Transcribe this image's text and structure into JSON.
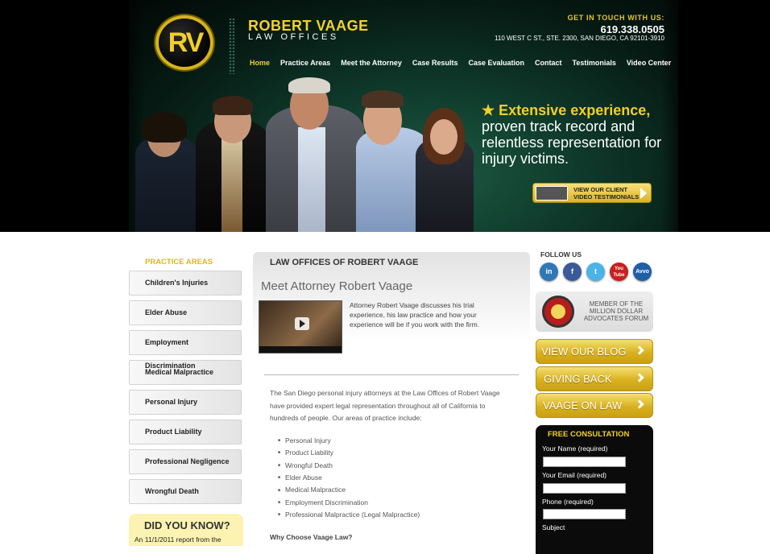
{
  "header": {
    "logo_text": "RV",
    "firm_name": "ROBERT VAAGE",
    "firm_sub": "LAW OFFICES",
    "contact_label": "GET IN TOUCH WITH US:",
    "phone": "619.338.0505",
    "address": "110 WEST C ST., STE. 2300, SAN DIEGO, CA 92101-3910"
  },
  "nav": [
    "Home",
    "Practice Areas",
    "Meet the Attorney",
    "Case Results",
    "Case Evaluation",
    "Contact",
    "Testimonials",
    "Video Center"
  ],
  "hero": {
    "star": "★",
    "tagline_highlight": "Extensive experience,",
    "tagline_rest": "proven track record and relentless representation for injury victims.",
    "video_button_line1": "VIEW OUR CLIENT",
    "video_button_line2": "VIDEO TESTIMONIALS"
  },
  "sidebar": {
    "title": "PRACTICE AREAS",
    "items": [
      "Children's Injuries",
      "Elder Abuse",
      "Employment Discrimination",
      "Medical Malpractice",
      "Personal Injury",
      "Product Liability",
      "Professional Negligence",
      "Wrongful Death"
    ],
    "dyk_title": "DID YOU KNOW?",
    "dyk_text": "An 11/1/2011 report from the"
  },
  "main": {
    "heading": "LAW OFFICES OF ROBERT VAAGE",
    "subheading": "Meet Attorney Robert Vaage",
    "video_desc": "Attorney Robert Vaage discusses his trial experience, his law practice and how your experience will be if you work with the firm.",
    "body": "The San Diego personal injury attorneys at the Law Offices of Robert Vaage have provided expert legal representation throughout all of California to hundreds of people.   Our areas of practice include:",
    "bullets": [
      "Personal Injury",
      "Product Liability",
      "Wrongful Death",
      "Elder Abuse",
      "Medical Malpractice",
      "Employment Discrimination",
      "Professional Malpractice (Legal Malpractice)"
    ],
    "why": "Why Choose Vaage Law?"
  },
  "right": {
    "follow": "FOLLOW US",
    "social": [
      {
        "label": "in",
        "icon": "linkedin-icon",
        "color": "#2f78b6"
      },
      {
        "label": "f",
        "icon": "facebook-icon",
        "color": "#3a5a99"
      },
      {
        "label": "t",
        "icon": "twitter-icon",
        "color": "#4ab3e8"
      },
      {
        "label": "You Tube",
        "icon": "youtube-icon",
        "color": "#c8201e"
      },
      {
        "label": "Avvo",
        "icon": "avvo-icon",
        "color": "#1f5fa6"
      }
    ],
    "madf_text": "MEMBER OF THE MILLION DOLLAR ADVOCATES FORUM",
    "buttons": [
      "VIEW OUR BLOG",
      "GIVING BACK",
      "VAAGE ON LAW"
    ],
    "consult_title": "FREE CONSULTATION",
    "form_labels": [
      "Your Name (required)",
      "Your Email (required)",
      "Phone (required)",
      "Subject"
    ]
  },
  "colors": {
    "accent": "#f2cf2a",
    "hero_green": "#0f3a2b"
  }
}
